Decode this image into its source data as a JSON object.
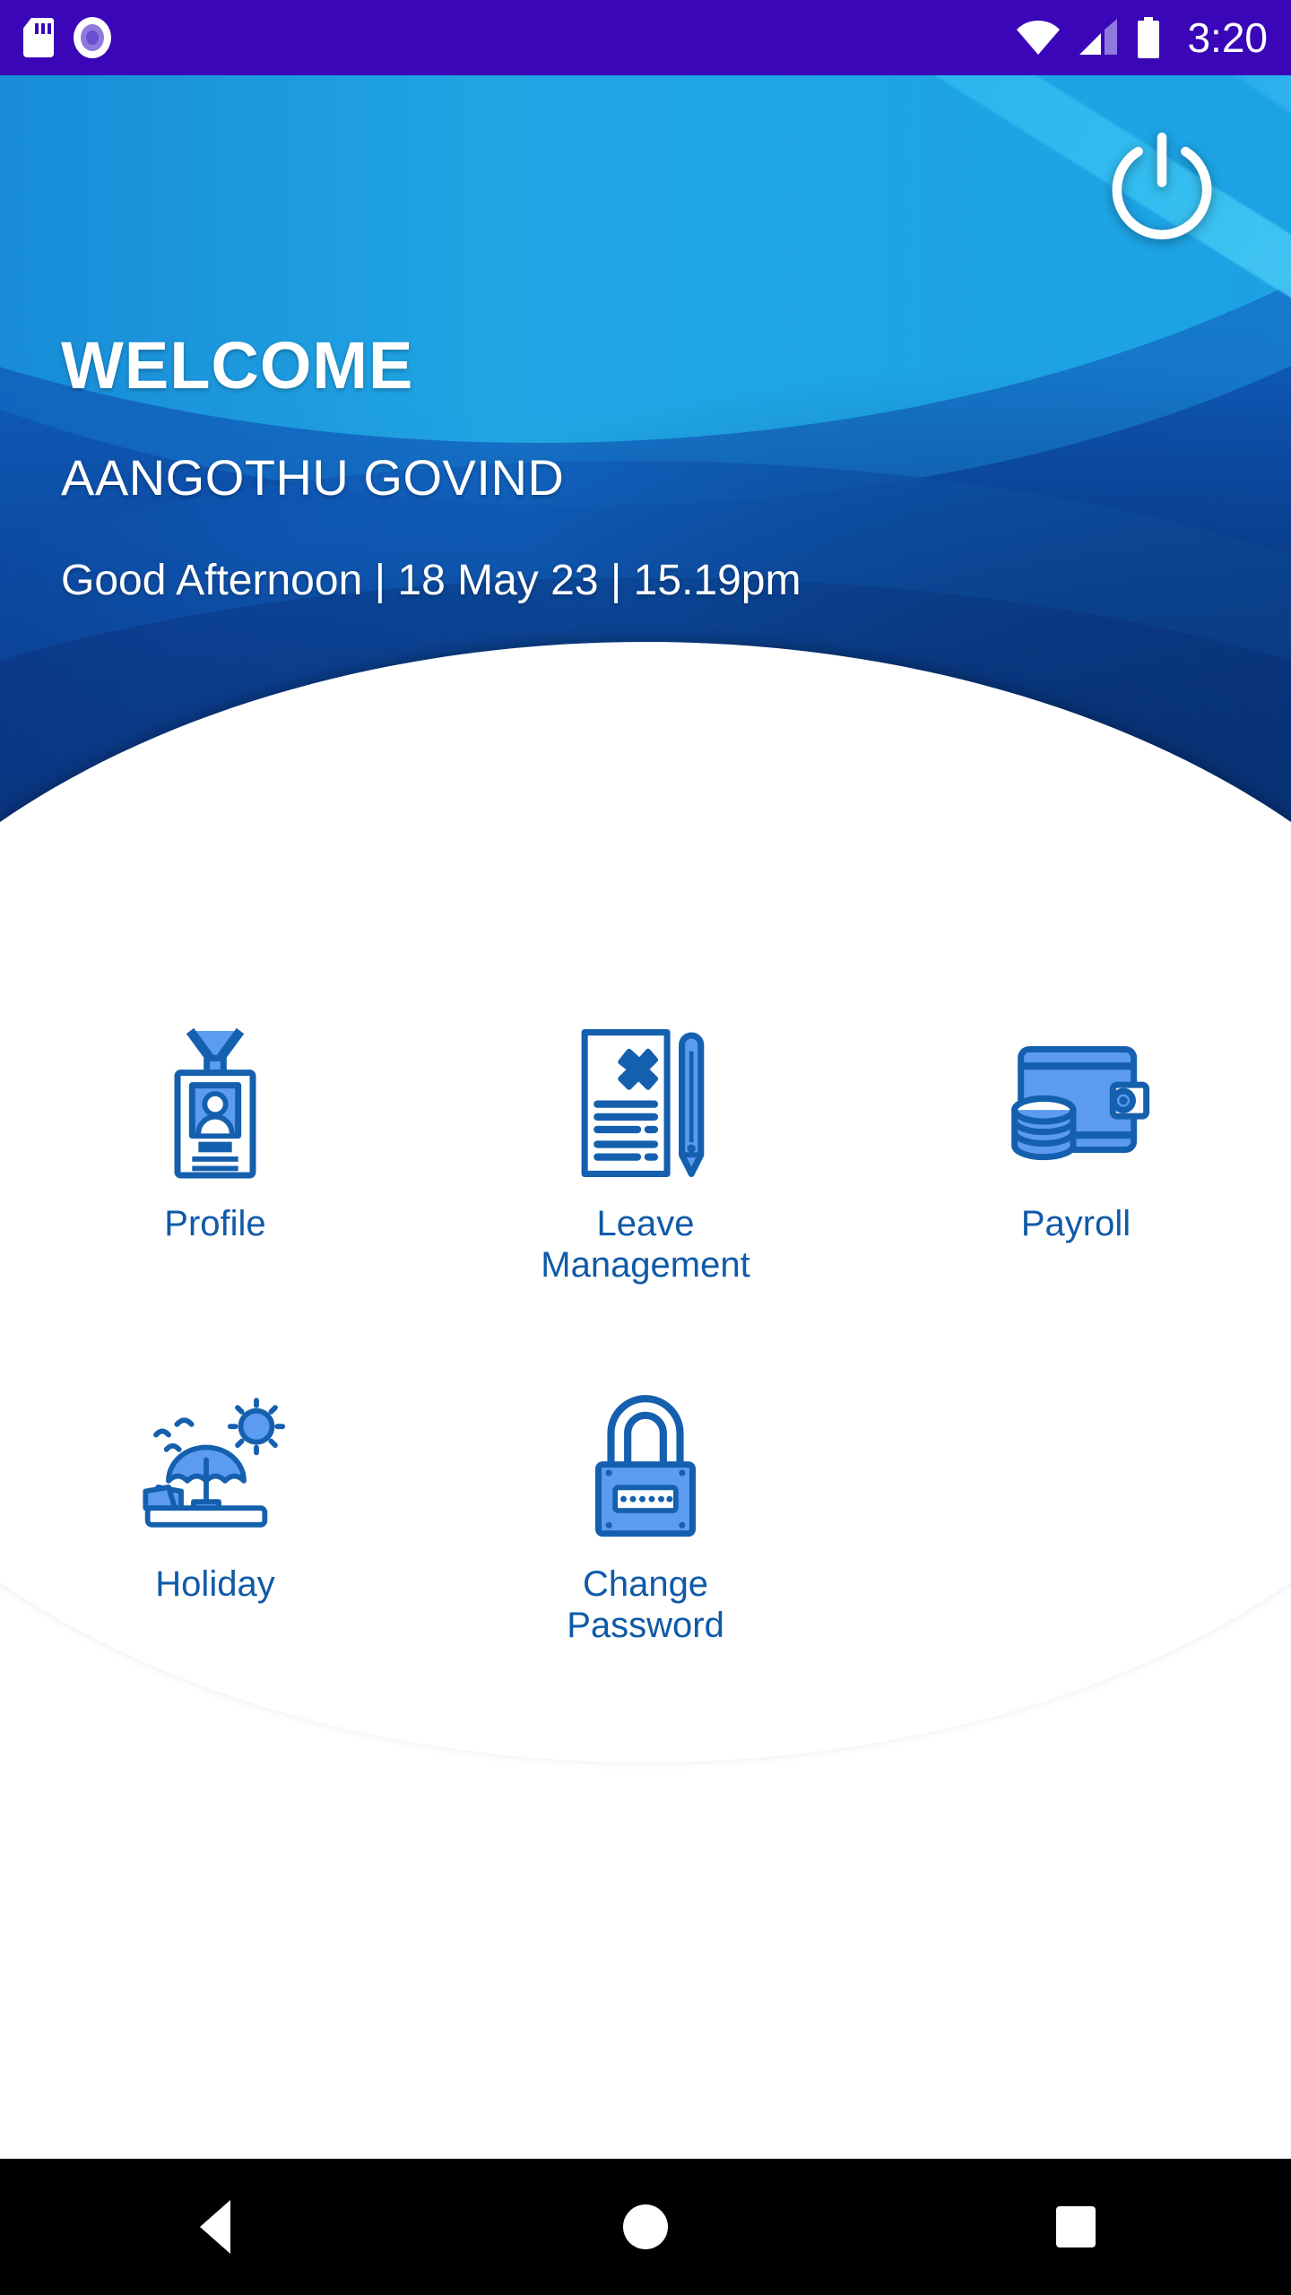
{
  "statusbar": {
    "time": "3:20",
    "icons": [
      "sd-card-icon",
      "record-circle-icon",
      "wifi-icon",
      "cellular-signal-icon",
      "battery-icon"
    ]
  },
  "header": {
    "welcome_title": "WELCOME",
    "user_name": "AANGOTHU GOVIND",
    "greeting": "Good Afternoon | 18 May 23 | 15.19pm",
    "power_button_label": "Logout",
    "colors": {
      "gradient_top": "#1169c9",
      "gradient_bottom": "#0a3280",
      "accent_cyan": "#27c6ef"
    }
  },
  "menu": {
    "accent_color": "#0f5aa8",
    "icon_fill": "#5b9bf0",
    "icon_stroke": "#1560ae",
    "rows": [
      [
        {
          "id": "profile",
          "label": "Profile",
          "icon": "id-badge-icon"
        },
        {
          "id": "leave-management",
          "label": "Leave\nManagement",
          "icon": "document-airplane-pencil-icon"
        },
        {
          "id": "payroll",
          "label": "Payroll",
          "icon": "wallet-coins-icon"
        }
      ],
      [
        {
          "id": "holiday",
          "label": "Holiday",
          "icon": "beach-umbrella-icon"
        },
        {
          "id": "change-password",
          "label": "Change\nPassword",
          "icon": "padlock-icon"
        }
      ]
    ]
  },
  "navbar": {
    "back_label": "Back",
    "home_label": "Home",
    "recents_label": "Recents"
  }
}
